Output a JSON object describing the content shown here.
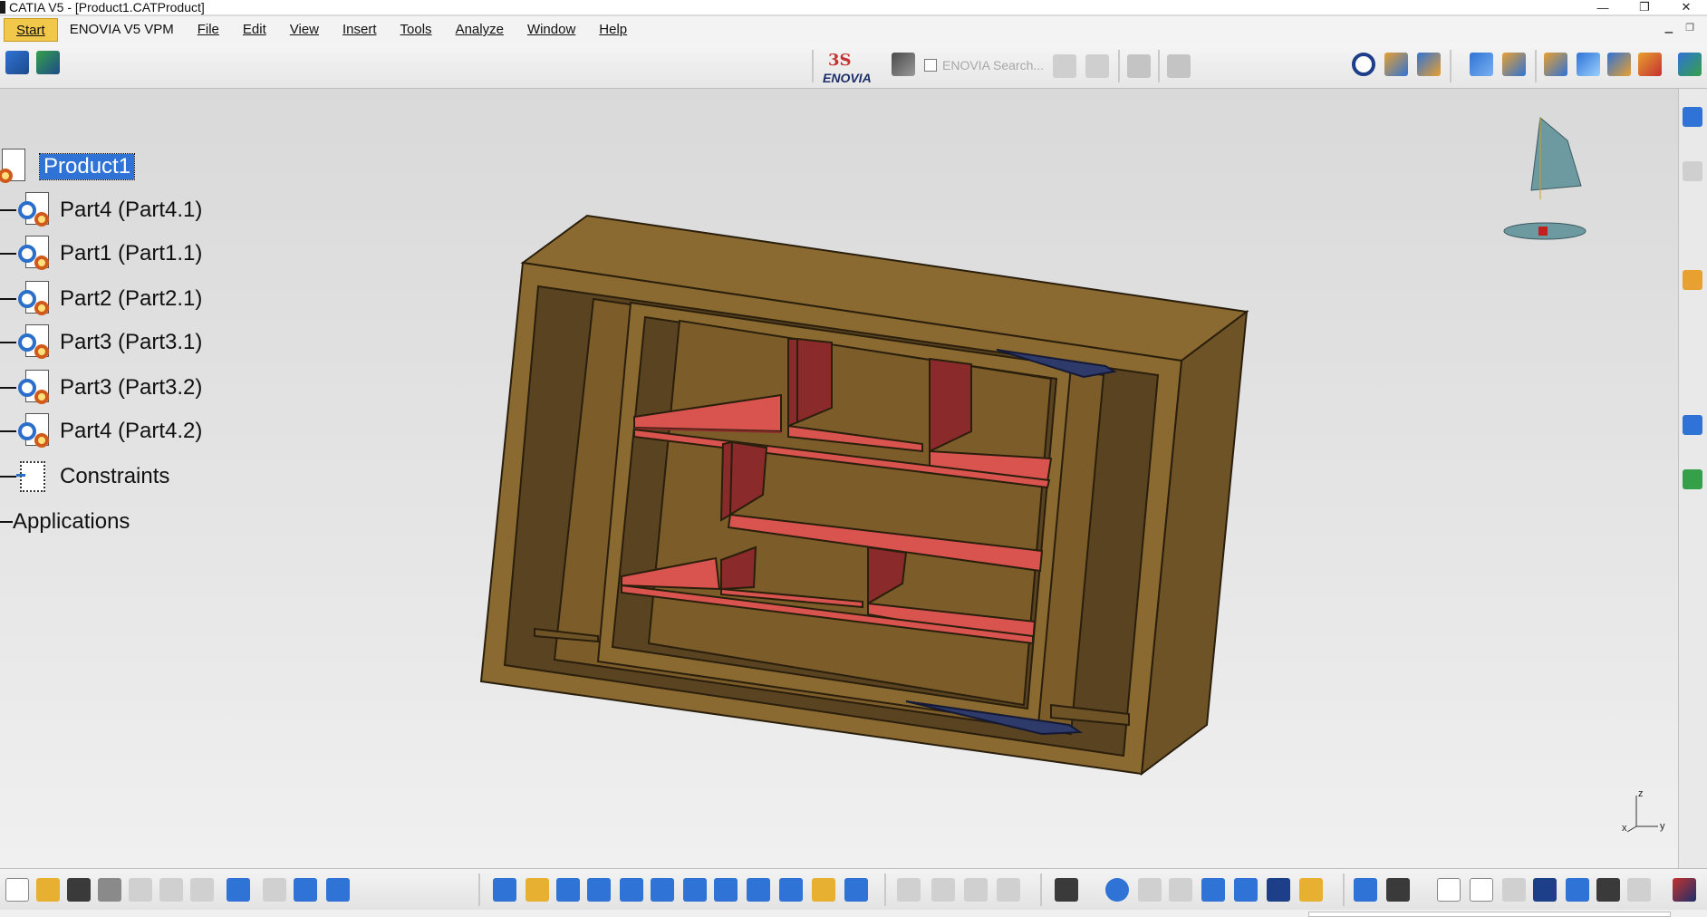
{
  "window": {
    "title": "CATIA V5 - [Product1.CATProduct]",
    "minimize": "—",
    "restore": "❐",
    "close": "✕"
  },
  "menu": {
    "items": [
      "Start",
      "ENOVIA V5 VPM",
      "File",
      "Edit",
      "View",
      "Insert",
      "Tools",
      "Analyze",
      "Window",
      "Help"
    ]
  },
  "toolbar": {
    "enovia_logo_ds": "3S",
    "enovia_logo_text": "ENOVIA",
    "enovia_search": "ENOVIA Search..."
  },
  "tree": {
    "root": "Product1",
    "children": [
      {
        "label": "Part4 (Part4.1)",
        "icon": "part-icon"
      },
      {
        "label": "Part1 (Part1.1)",
        "icon": "part-icon"
      },
      {
        "label": "Part2 (Part2.1)",
        "icon": "part-icon"
      },
      {
        "label": "Part3 (Part3.1)",
        "icon": "part-icon"
      },
      {
        "label": "Part3 (Part3.2)",
        "icon": "part-icon"
      },
      {
        "label": "Part4 (Part4.2)",
        "icon": "part-icon"
      },
      {
        "label": "Constraints",
        "icon": "constraints-icon"
      },
      {
        "label": "Applications",
        "icon": "none"
      }
    ]
  },
  "axis": {
    "z": "z",
    "x": "x",
    "y": "y"
  },
  "colors": {
    "frame": "#8a6a30",
    "frame_dark": "#5a4320",
    "frame_side": "#6e5326",
    "shelf": "#d9534f",
    "shelf_dark": "#8b2a2a",
    "selection": "#2f73d6",
    "start_menu": "#f2c84a"
  }
}
